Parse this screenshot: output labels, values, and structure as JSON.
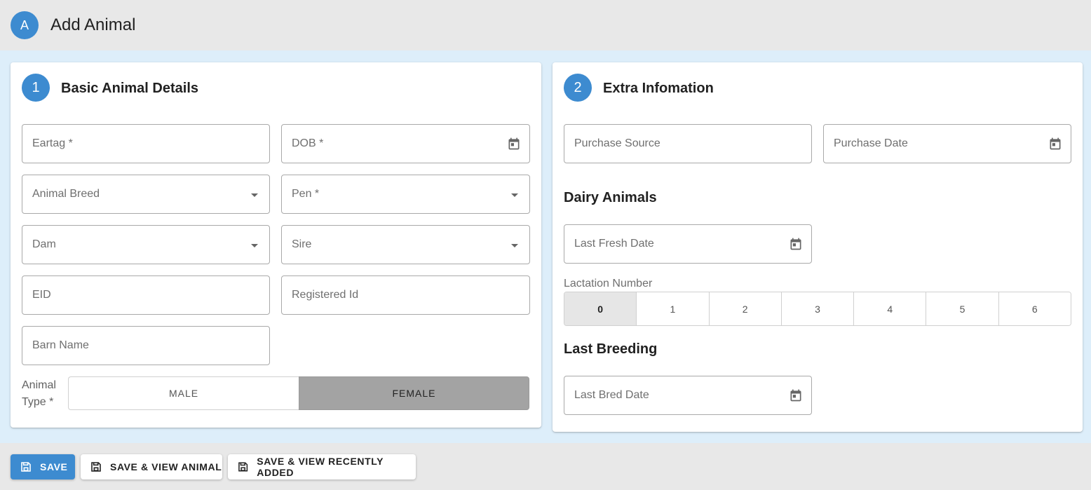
{
  "header": {
    "avatar": "A",
    "title": "Add Animal"
  },
  "basic": {
    "step": "1",
    "title": "Basic Animal Details",
    "eartag": "Eartag *",
    "dob": "DOB *",
    "breed": "Animal Breed",
    "pen": "Pen *",
    "dam": "Dam",
    "sire": "Sire",
    "eid": "EID",
    "registered_id": "Registered Id",
    "barn_name": "Barn Name",
    "animal_type_label": "Animal Type *",
    "animal_type_options": [
      "MALE",
      "FEMALE"
    ],
    "animal_type_selected": "FEMALE"
  },
  "extra": {
    "step": "2",
    "title": "Extra Infomation",
    "purchase_source": "Purchase Source",
    "purchase_date": "Purchase Date",
    "dairy_title": "Dairy Animals",
    "last_fresh_date": "Last Fresh Date",
    "lactation_label": "Lactation Number",
    "lactation_options": [
      "0",
      "1",
      "2",
      "3",
      "4",
      "5",
      "6"
    ],
    "lactation_selected": "0",
    "breeding_title": "Last Breeding",
    "last_bred_date": "Last Bred Date"
  },
  "footer": {
    "save": "SAVE",
    "save_view": "SAVE & VIEW ANIMAL",
    "save_recent": "SAVE & VIEW RECENTLY ADDED"
  },
  "colors": {
    "primary": "#3d8bd0",
    "selected_toggle": "#a3a3a3",
    "background": "#ddeefa",
    "bar": "#e8e8e8"
  },
  "icons": {
    "date": "calendar-icon",
    "dropdown": "chevron-down-icon",
    "save": "floppy-disk-icon"
  }
}
